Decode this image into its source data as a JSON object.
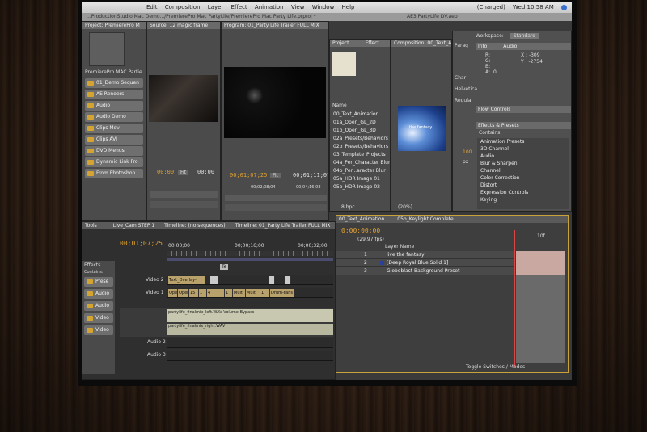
{
  "menubar": {
    "left_items": [
      "Edit",
      "Composition",
      "Layer",
      "Effect",
      "Animation",
      "View",
      "Window",
      "Help"
    ],
    "charged_text": "(Charged)",
    "clock": "Wed 10:58 AM"
  },
  "titlebar": {
    "left_path": "...ProductionStudio Mac Demo.../PremierePro Mac PartyLife/PremierePro Mac Party Life.prproj *",
    "right_file": "AE3 PartyLife DV.aep"
  },
  "project_panel": {
    "tab": "Project: PremierePro M",
    "name_label": "PremierePro MAC Partie",
    "items": [
      "01_Demo Sequen",
      "AE Renders",
      "Audio",
      "Audio Demo",
      "Clips Mov",
      "Clips AVI",
      "DVD Menus",
      "Dynamic Link Fro",
      "From Photoshop"
    ]
  },
  "source_monitor": {
    "tab": "Source: 12 magic frame",
    "timecode": "00;00",
    "timecode_right": "00;00",
    "fit": "Fit"
  },
  "program_monitor": {
    "tab": "Program: 01_Party Life Trailer FULL MIX",
    "timecode": "00;01;07;25",
    "fit": "Fit",
    "duration": "00;01;11;07",
    "ruler_mid": "00;02;08;04",
    "ruler_end": "00;04;16;08"
  },
  "timeline": {
    "tools_tab": "Tools",
    "cam_tab": "Live_Cam STEP 1",
    "empty_tab": "Timeline: (no sequences)",
    "main_tab": "Timeline: 01_Party Life Trailer FULL MIX",
    "timecode": "00;01;07;25",
    "ruler_start": "00;00;00",
    "ruler_mid": "00;00;16;00",
    "ruler_end": "00;00;32;00",
    "te_marker": "Te",
    "tracks": {
      "video2": "Video 2",
      "video1": "Video 1",
      "audio2": "Audio 2",
      "audio3": "Audio 3"
    },
    "video2_clip": "Text_Overlay-",
    "video1_clips": [
      "Open",
      "Open",
      "15",
      "1",
      "4",
      "1",
      "Multi",
      "Multi",
      "1",
      "Drum-Fans"
    ],
    "audio_left": "partylife_finalmix_left.WAV Volume:Bypass",
    "audio_right": "partylife_finalmix_right.WAV",
    "effects_tab": "Effects",
    "effects_contains": "Contains:",
    "effects_items": [
      "Prese",
      "Audio",
      "Audio",
      "Video",
      "Video"
    ]
  },
  "ae_project": {
    "tab": "Project",
    "tab2": "Effect",
    "name_col": "Name",
    "items": [
      "00_Text_Animation",
      "01a_Open_GL_2D",
      "01b_Open_GL_3D",
      "02a_Presets/Behaviors",
      "02b_Presets/Behaviors",
      "03_Template_Projects",
      "04a_Per_Character Blur",
      "04b_Per...aracter Blur",
      "05a_HDR Image 01",
      "05b_HDR Image 02"
    ],
    "bpc": "8 bpc"
  },
  "ae_comp": {
    "tab": "Composition: 00_Text_A",
    "zoom": "(20%)",
    "comp_text": "the fantasy"
  },
  "ae_right": {
    "workspace_label": "Workspace:",
    "workspace_value": "Standard",
    "info_tab": "Info",
    "audio_tab": "Audio",
    "r": "R:",
    "g": "G:",
    "b": "B:",
    "a": "A:",
    "a_val": "0",
    "x": "X : -309",
    "y": "Y : -2754",
    "para_tab": "Parag",
    "char_tab": "Char",
    "font": "Helvetica",
    "style": "Regular",
    "px": "px",
    "size_val": "100",
    "flow_tab": "Flow Controls",
    "effects_tab": "Effects & Presets",
    "contains": "Contains:",
    "effects_items": [
      "Animation Presets",
      "3D Channel",
      "Audio",
      "Blur & Sharpen",
      "Channel",
      "Color Correction",
      "Distort",
      "Expression Controls",
      "Keying"
    ]
  },
  "ae_timeline": {
    "tab1": "00_Text_Animation",
    "tab2": "05b_Keylight Complete",
    "timecode": "0;00;00;00",
    "fps": "(29.97 fps)",
    "layer_name_col": "Layer Name",
    "layers": [
      {
        "num": "1",
        "name": "live the fantasy"
      },
      {
        "num": "2",
        "name": "[Deep Royal Blue Solid 1]"
      },
      {
        "num": "3",
        "name": "Globeblast Background Preset"
      }
    ],
    "ruler_label": "10f",
    "toggle": "Toggle Switches / Modes"
  },
  "colors": {
    "timecode_orange": "#e0a030",
    "ae_timeline_border": "#c9a23a",
    "folder_gold": "#d4a431",
    "clip_tan": "#b9a16b"
  }
}
